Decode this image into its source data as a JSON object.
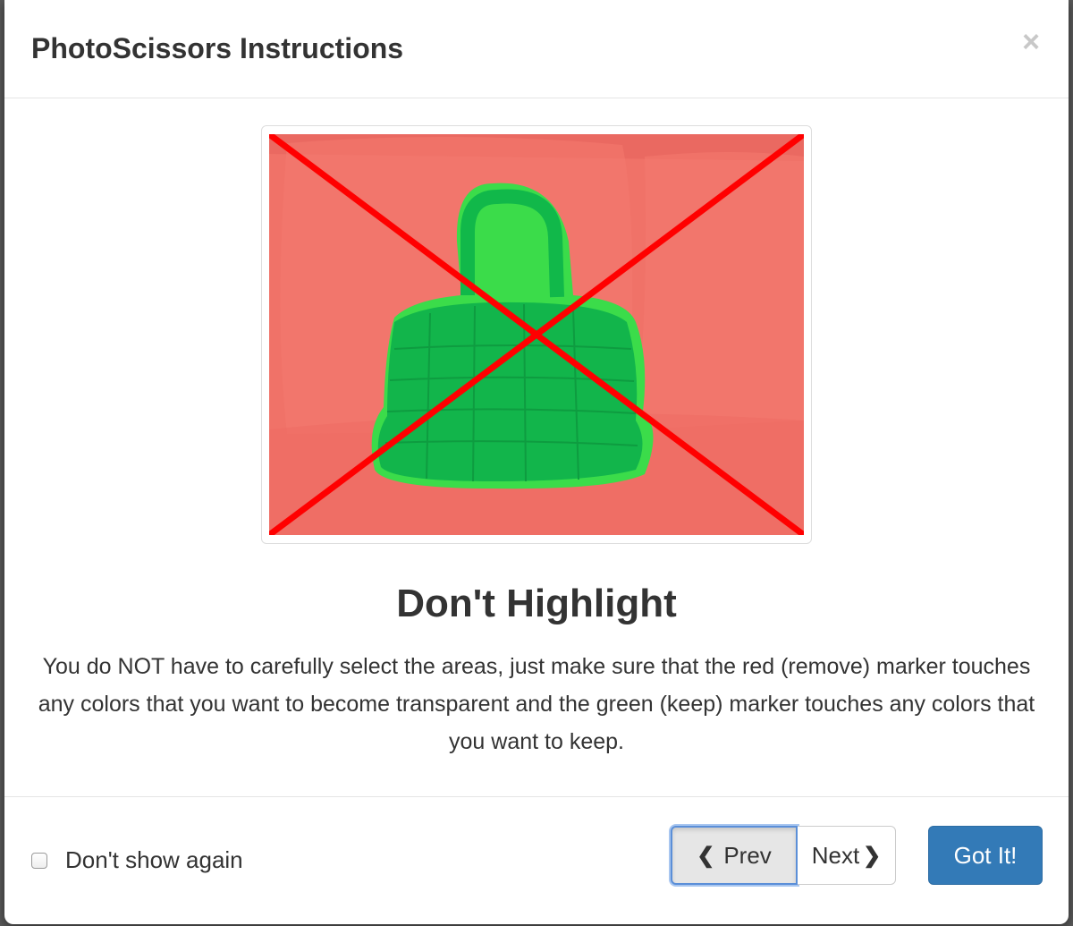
{
  "modal": {
    "title": "PhotoScissors Instructions",
    "close_label": "×"
  },
  "step": {
    "title": "Don't Highlight",
    "description": "You do NOT have to carefully select the areas, just make sure that the red (remove) marker touches any colors that you want to become transparent and the green (keep) marker touches any colors that you want to keep."
  },
  "footer": {
    "checkbox_label": "Don't show again",
    "checkbox_checked": false,
    "prev_label": "Prev",
    "next_label": "Next",
    "gotit_label": "Got It!"
  },
  "colors": {
    "primary_button": "#337ab7",
    "remove_marker": "#f07268",
    "keep_marker": "#22c55e",
    "cross": "#ff0000"
  }
}
